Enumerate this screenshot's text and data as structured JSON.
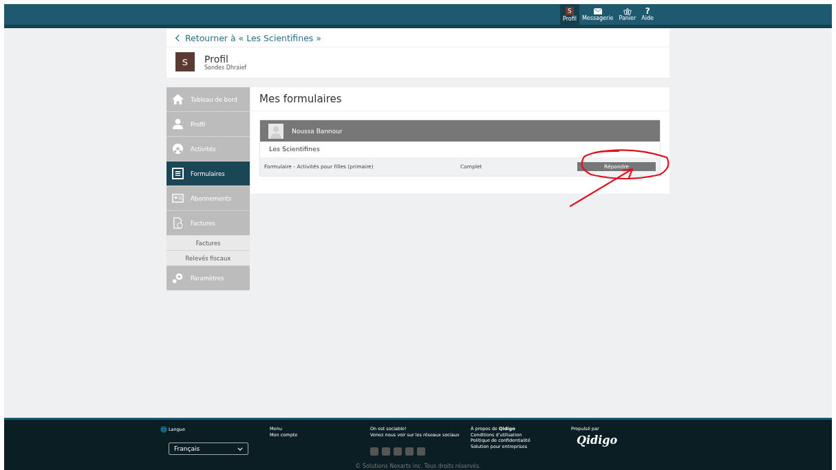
{
  "topbar": {
    "items": [
      {
        "label": "Profil",
        "avatar": "S",
        "selected": true
      },
      {
        "label": "Messagerie",
        "selected": false
      },
      {
        "label": "Panier",
        "selected": false
      },
      {
        "label": "Aide",
        "glyph": "?",
        "selected": false
      }
    ]
  },
  "back_link": "Retourner à « Les Scientifines »",
  "profile": {
    "avatar": "S",
    "title": "Profil",
    "name": "Sondes Dhraief"
  },
  "sidebar": {
    "items": [
      {
        "label": "Tableau de bord",
        "selected": false
      },
      {
        "label": "Profil",
        "selected": false
      },
      {
        "label": "Activités",
        "selected": false
      },
      {
        "label": "Formulaires",
        "selected": true
      },
      {
        "label": "Abonnements",
        "selected": false
      },
      {
        "label": "Factures",
        "selected": false,
        "children": [
          {
            "label": "Factures"
          },
          {
            "label": "Relevés fiscaux"
          }
        ]
      },
      {
        "label": "Paramètres",
        "selected": false
      }
    ]
  },
  "main": {
    "title": "Mes formulaires",
    "groups": [
      {
        "person": "Noussa Bannour",
        "organization": "Les Scientifines",
        "forms": [
          {
            "name": "Formulaire - Activités pour filles (primaire)",
            "status": "Complet",
            "action": "Répondre"
          }
        ]
      }
    ]
  },
  "footer": {
    "language_label": "Langue",
    "language": "Français",
    "menu": [
      "Menu",
      "Mon compte"
    ],
    "social": [
      "On est sociable!",
      "Venez nous voir sur les réseaux sociaux"
    ],
    "about": [
      "À propos de **Qidigo**",
      "Conditions d'utilisation",
      "Politique de confidentialité",
      "Solution pour entreprises"
    ],
    "powered_by": "Propulsé par",
    "logo": "Qidigo",
    "copyright": "© Solutions Nexarts inc. Tous droits réservés."
  }
}
